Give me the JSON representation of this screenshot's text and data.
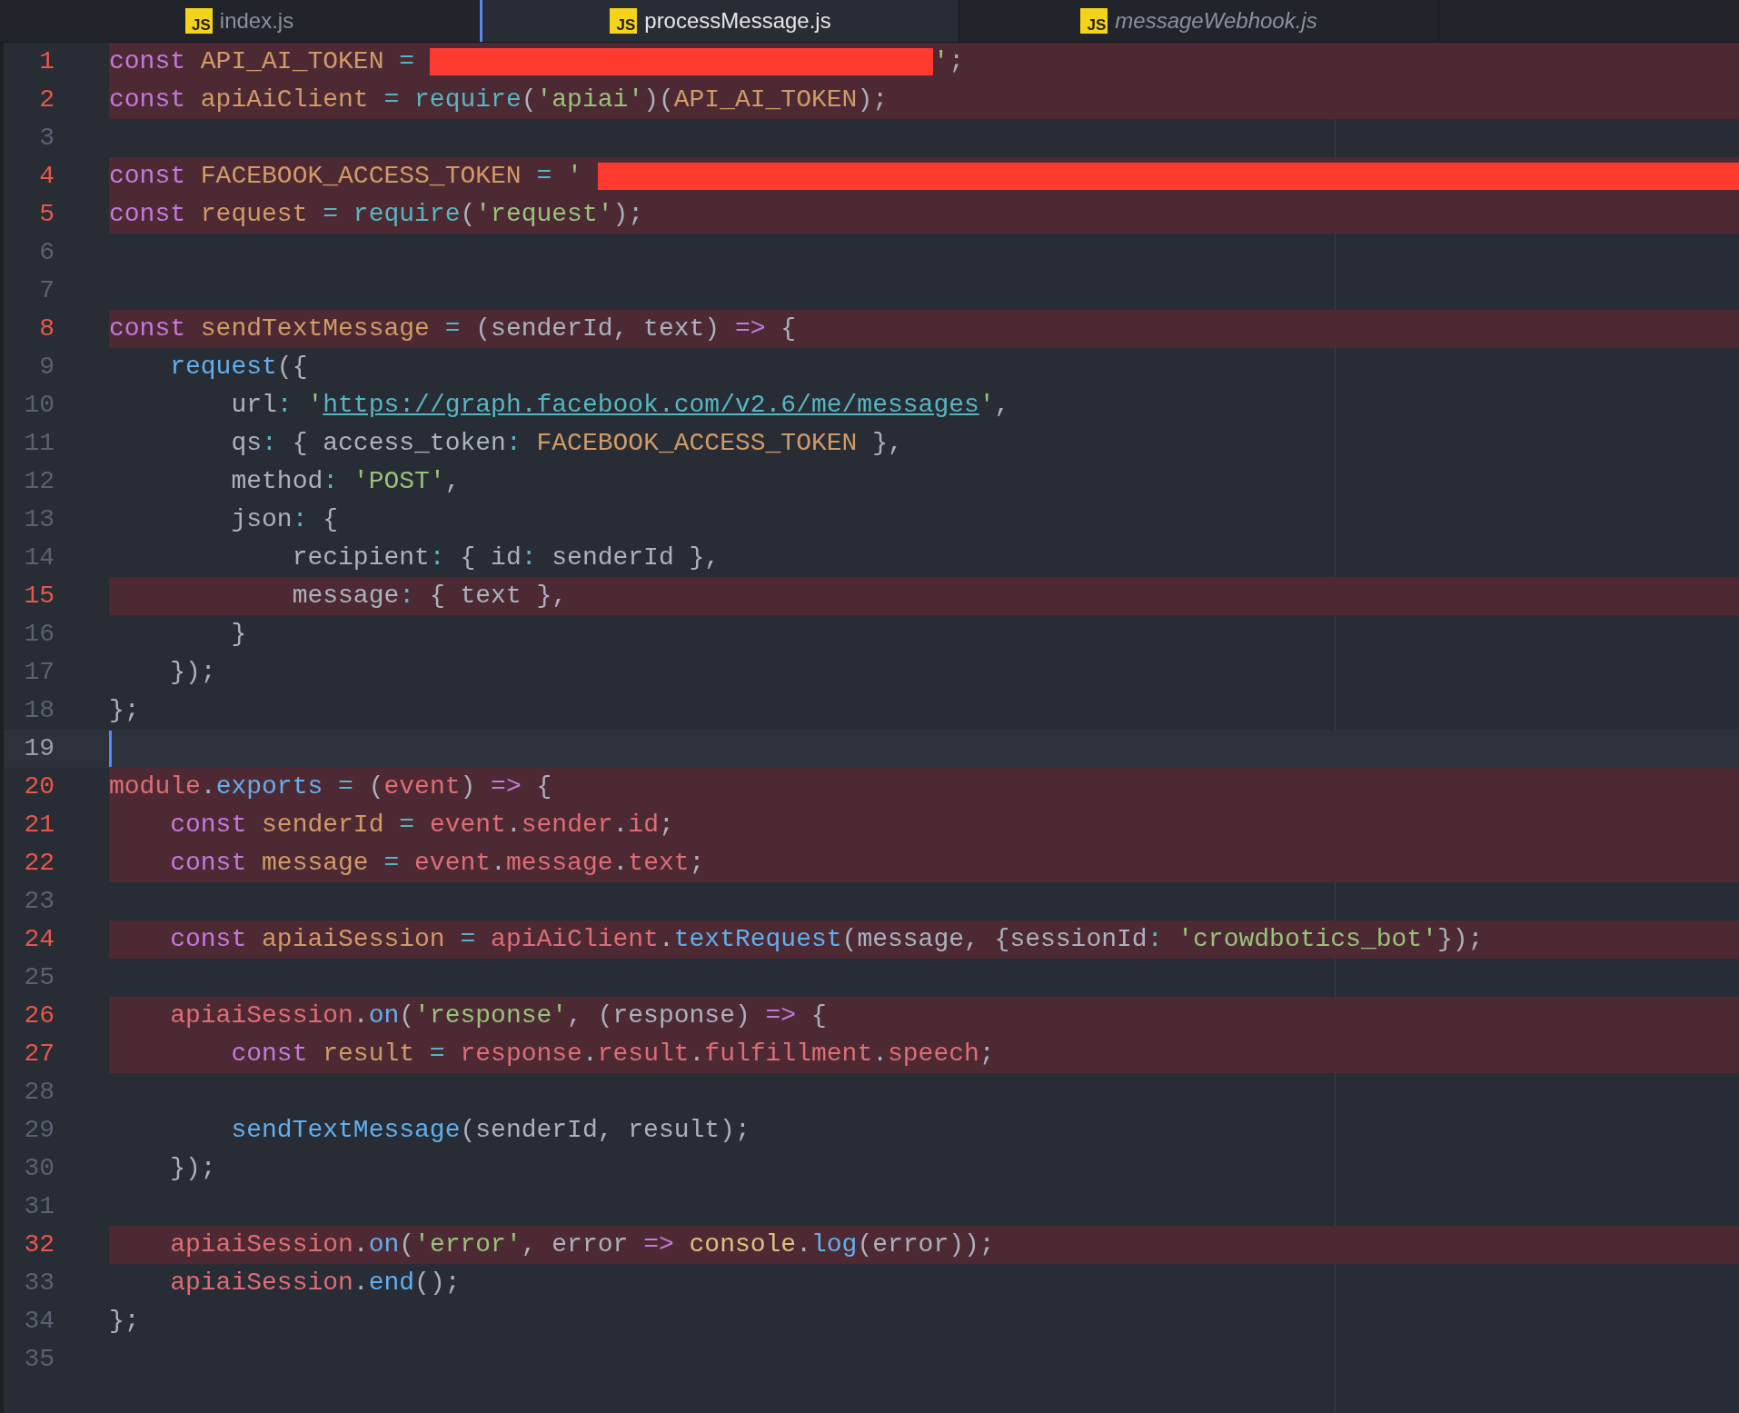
{
  "tabs": [
    {
      "label": "index.js",
      "icon_text": "JS",
      "selected": false,
      "preview": false
    },
    {
      "label": "processMessage.js",
      "icon_text": "JS",
      "selected": true,
      "preview": false
    },
    {
      "label": "messageWebhook.js",
      "icon_text": "JS",
      "selected": false,
      "preview": true
    }
  ],
  "lines": [
    {
      "number": "1",
      "modified": true,
      "tokens": [
        {
          "text": "const",
          "kind": "k"
        },
        {
          "text": " API_AI_TOKEN",
          "kind": "v"
        },
        {
          "text": " =",
          "kind": "o"
        },
        {
          "kind": "redacted",
          "to_edge": false
        },
        {
          "text": "'",
          "kind": "s"
        },
        {
          "text": ";",
          "kind": "p"
        }
      ]
    },
    {
      "number": "2",
      "modified": true,
      "tokens": [
        {
          "text": "const",
          "kind": "k"
        },
        {
          "text": " apiAiClient",
          "kind": "v"
        },
        {
          "text": " =",
          "kind": "o"
        },
        {
          "text": " require",
          "kind": "o"
        },
        {
          "text": "(",
          "kind": "p"
        },
        {
          "text": "'apiai'",
          "kind": "s"
        },
        {
          "text": ")(",
          "kind": "p"
        },
        {
          "text": "API_AI_TOKEN",
          "kind": "v"
        },
        {
          "text": ");",
          "kind": "p"
        }
      ]
    },
    {
      "number": "3",
      "modified": false
    },
    {
      "number": "4",
      "modified": true,
      "tokens": [
        {
          "text": "const",
          "kind": "k"
        },
        {
          "text": " FACEBOOK_ACCESS_TOKEN",
          "kind": "v"
        },
        {
          "text": " =",
          "kind": "o"
        },
        {
          "text": " '",
          "kind": "s"
        },
        {
          "kind": "redacted",
          "to_edge": true
        }
      ]
    },
    {
      "number": "5",
      "modified": true,
      "tokens": [
        {
          "text": "const",
          "kind": "k"
        },
        {
          "text": " request",
          "kind": "v"
        },
        {
          "text": " =",
          "kind": "o"
        },
        {
          "text": " require",
          "kind": "o"
        },
        {
          "text": "(",
          "kind": "p"
        },
        {
          "text": "'request'",
          "kind": "s"
        },
        {
          "text": ");",
          "kind": "p"
        }
      ]
    },
    {
      "number": "6",
      "modified": false
    },
    {
      "number": "7",
      "modified": false
    },
    {
      "number": "8",
      "modified": true,
      "tokens": [
        {
          "text": "const",
          "kind": "k"
        },
        {
          "text": " sendTextMessage",
          "kind": "v"
        },
        {
          "text": " =",
          "kind": "o"
        },
        {
          "text": " (senderId, text) ",
          "kind": "p"
        },
        {
          "text": "=>",
          "kind": "k"
        },
        {
          "text": " {",
          "kind": "p"
        }
      ]
    },
    {
      "number": "9",
      "modified": false,
      "tokens": [
        {
          "text": "    request",
          "kind": "f"
        },
        {
          "text": "({",
          "kind": "p"
        }
      ]
    },
    {
      "number": "10",
      "modified": false,
      "tokens": [
        {
          "text": "        url",
          "kind": "p"
        },
        {
          "text": ":",
          "kind": "o"
        },
        {
          "text": " '",
          "kind": "s"
        },
        {
          "text": "https://graph.facebook.com/v2.6/me/messages",
          "kind": "u"
        },
        {
          "text": "'",
          "kind": "s"
        },
        {
          "text": ",",
          "kind": "p"
        }
      ]
    },
    {
      "number": "11",
      "modified": false,
      "tokens": [
        {
          "text": "        qs",
          "kind": "p"
        },
        {
          "text": ":",
          "kind": "o"
        },
        {
          "text": " { access_token",
          "kind": "p"
        },
        {
          "text": ":",
          "kind": "o"
        },
        {
          "text": " FACEBOOK_ACCESS_TOKEN",
          "kind": "v"
        },
        {
          "text": " },",
          "kind": "p"
        }
      ]
    },
    {
      "number": "12",
      "modified": false,
      "tokens": [
        {
          "text": "        method",
          "kind": "p"
        },
        {
          "text": ":",
          "kind": "o"
        },
        {
          "text": " 'POST'",
          "kind": "s"
        },
        {
          "text": ",",
          "kind": "p"
        }
      ]
    },
    {
      "number": "13",
      "modified": false,
      "tokens": [
        {
          "text": "        json",
          "kind": "p"
        },
        {
          "text": ":",
          "kind": "o"
        },
        {
          "text": " {",
          "kind": "p"
        }
      ]
    },
    {
      "number": "14",
      "modified": false,
      "tokens": [
        {
          "text": "            recipient",
          "kind": "p"
        },
        {
          "text": ":",
          "kind": "o"
        },
        {
          "text": " { id",
          "kind": "p"
        },
        {
          "text": ":",
          "kind": "o"
        },
        {
          "text": " senderId },",
          "kind": "p"
        }
      ]
    },
    {
      "number": "15",
      "modified": true,
      "tokens": [
        {
          "text": "            message",
          "kind": "p"
        },
        {
          "text": ":",
          "kind": "o"
        },
        {
          "text": " { text },",
          "kind": "p"
        }
      ]
    },
    {
      "number": "16",
      "modified": false,
      "tokens": [
        {
          "text": "        }",
          "kind": "p"
        }
      ]
    },
    {
      "number": "17",
      "modified": false,
      "tokens": [
        {
          "text": "    });",
          "kind": "p"
        }
      ]
    },
    {
      "number": "18",
      "modified": false,
      "tokens": [
        {
          "text": "};",
          "kind": "p"
        }
      ]
    },
    {
      "number": "19",
      "modified": false,
      "cursor": true
    },
    {
      "number": "20",
      "modified": true,
      "tokens": [
        {
          "text": "module",
          "kind": "r"
        },
        {
          "text": ".",
          "kind": "p"
        },
        {
          "text": "exports",
          "kind": "f"
        },
        {
          "text": " =",
          "kind": "o"
        },
        {
          "text": " (",
          "kind": "p"
        },
        {
          "text": "event",
          "kind": "r"
        },
        {
          "text": ") ",
          "kind": "p"
        },
        {
          "text": "=>",
          "kind": "k"
        },
        {
          "text": " {",
          "kind": "p"
        }
      ]
    },
    {
      "number": "21",
      "modified": true,
      "tokens": [
        {
          "text": "    const",
          "kind": "k"
        },
        {
          "text": " senderId",
          "kind": "v"
        },
        {
          "text": " =",
          "kind": "o"
        },
        {
          "text": " event",
          "kind": "r"
        },
        {
          "text": ".",
          "kind": "p"
        },
        {
          "text": "sender",
          "kind": "r"
        },
        {
          "text": ".",
          "kind": "p"
        },
        {
          "text": "id",
          "kind": "r"
        },
        {
          "text": ";",
          "kind": "p"
        }
      ]
    },
    {
      "number": "22",
      "modified": true,
      "tokens": [
        {
          "text": "    const",
          "kind": "k"
        },
        {
          "text": " message",
          "kind": "v"
        },
        {
          "text": " =",
          "kind": "o"
        },
        {
          "text": " event",
          "kind": "r"
        },
        {
          "text": ".",
          "kind": "p"
        },
        {
          "text": "message",
          "kind": "r"
        },
        {
          "text": ".",
          "kind": "p"
        },
        {
          "text": "text",
          "kind": "r"
        },
        {
          "text": ";",
          "kind": "p"
        }
      ]
    },
    {
      "number": "23",
      "modified": false
    },
    {
      "number": "24",
      "modified": true,
      "tokens": [
        {
          "text": "    const",
          "kind": "k"
        },
        {
          "text": " apiaiSession",
          "kind": "v"
        },
        {
          "text": " =",
          "kind": "o"
        },
        {
          "text": " apiAiClient",
          "kind": "r"
        },
        {
          "text": ".",
          "kind": "p"
        },
        {
          "text": "textRequest",
          "kind": "f"
        },
        {
          "text": "(message, {sessionId",
          "kind": "p"
        },
        {
          "text": ":",
          "kind": "o"
        },
        {
          "text": " 'crowdbotics_bot'",
          "kind": "s"
        },
        {
          "text": "});",
          "kind": "p"
        }
      ]
    },
    {
      "number": "25",
      "modified": false
    },
    {
      "number": "26",
      "modified": true,
      "tokens": [
        {
          "text": "    apiaiSession",
          "kind": "r"
        },
        {
          "text": ".",
          "kind": "p"
        },
        {
          "text": "on",
          "kind": "f"
        },
        {
          "text": "(",
          "kind": "p"
        },
        {
          "text": "'response'",
          "kind": "s"
        },
        {
          "text": ", (response) ",
          "kind": "p"
        },
        {
          "text": "=>",
          "kind": "k"
        },
        {
          "text": " {",
          "kind": "p"
        }
      ]
    },
    {
      "number": "27",
      "modified": true,
      "tokens": [
        {
          "text": "        const",
          "kind": "k"
        },
        {
          "text": " result",
          "kind": "v"
        },
        {
          "text": " =",
          "kind": "o"
        },
        {
          "text": " response",
          "kind": "r"
        },
        {
          "text": ".",
          "kind": "p"
        },
        {
          "text": "result",
          "kind": "r"
        },
        {
          "text": ".",
          "kind": "p"
        },
        {
          "text": "fulfillment",
          "kind": "r"
        },
        {
          "text": ".",
          "kind": "p"
        },
        {
          "text": "speech",
          "kind": "r"
        },
        {
          "text": ";",
          "kind": "p"
        }
      ]
    },
    {
      "number": "28",
      "modified": false
    },
    {
      "number": "29",
      "modified": false,
      "tokens": [
        {
          "text": "        sendTextMessage",
          "kind": "f"
        },
        {
          "text": "(senderId, result);",
          "kind": "p"
        }
      ]
    },
    {
      "number": "30",
      "modified": false,
      "tokens": [
        {
          "text": "    });",
          "kind": "p"
        }
      ]
    },
    {
      "number": "31",
      "modified": false
    },
    {
      "number": "32",
      "modified": true,
      "tokens": [
        {
          "text": "    apiaiSession",
          "kind": "r"
        },
        {
          "text": ".",
          "kind": "p"
        },
        {
          "text": "on",
          "kind": "f"
        },
        {
          "text": "(",
          "kind": "p"
        },
        {
          "text": "'error'",
          "kind": "s"
        },
        {
          "text": ", error ",
          "kind": "p"
        },
        {
          "text": "=>",
          "kind": "k"
        },
        {
          "text": " console",
          "kind": "y"
        },
        {
          "text": ".",
          "kind": "p"
        },
        {
          "text": "log",
          "kind": "f"
        },
        {
          "text": "(error));",
          "kind": "p"
        }
      ]
    },
    {
      "number": "33",
      "modified": false,
      "tokens": [
        {
          "text": "    apiaiSession",
          "kind": "r"
        },
        {
          "text": ".",
          "kind": "p"
        },
        {
          "text": "end",
          "kind": "f"
        },
        {
          "text": "();",
          "kind": "p"
        }
      ]
    },
    {
      "number": "34",
      "modified": false,
      "tokens": [
        {
          "text": "};",
          "kind": "p"
        }
      ]
    },
    {
      "number": "35",
      "modified": false
    }
  ]
}
